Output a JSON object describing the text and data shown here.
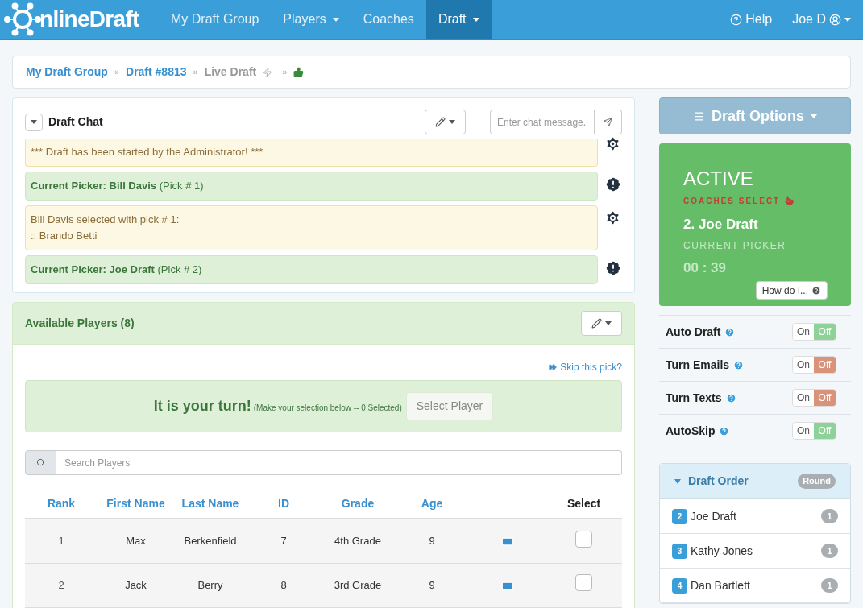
{
  "navbar": {
    "logo_text": "nlineDraft",
    "items": [
      {
        "label": "My Draft Group",
        "dropdown": false,
        "selected": false
      },
      {
        "label": "Players",
        "dropdown": true,
        "selected": false
      },
      {
        "label": "Coaches",
        "dropdown": false,
        "selected": false
      },
      {
        "label": "Draft",
        "dropdown": true,
        "selected": true
      }
    ],
    "help": "Help",
    "user": "Joe D"
  },
  "breadcrumb": {
    "links": [
      "My Draft Group",
      "Draft #8813"
    ],
    "separator": "»",
    "current": "Live Draft"
  },
  "chat": {
    "title": "Draft Chat",
    "placeholder": "Enter chat message.",
    "messages": [
      {
        "kind": "system",
        "lines": [
          "*** Draft has been started by the Administrator! ***"
        ]
      },
      {
        "kind": "picker",
        "bold": "Current Picker: Bill Davis",
        "note": "(Pick # 1)"
      },
      {
        "kind": "system",
        "lines": [
          "Bill Davis selected with pick # 1:",
          ":: Brando Betti"
        ]
      },
      {
        "kind": "picker",
        "bold": "Current Picker: Joe Draft",
        "note": "(Pick # 2)"
      }
    ]
  },
  "players": {
    "title": "Available Players (8)",
    "skip_link": "Skip this pick?",
    "turn_title": "It is your turn!",
    "turn_note": "(Make your selection below -- 0 Selected)",
    "select_button": "Select Player",
    "search_placeholder": "Search Players",
    "columns": [
      "Rank",
      "First Name",
      "Last Name",
      "ID",
      "Grade",
      "Age",
      "Select"
    ],
    "rows": [
      {
        "rank": "1",
        "first": "Max",
        "last": "Berkenfield",
        "id": "7",
        "grade": "4th Grade",
        "age": "9",
        "checked": false
      },
      {
        "rank": "2",
        "first": "Jack",
        "last": "Berry",
        "id": "8",
        "grade": "3rd Grade",
        "age": "9",
        "checked": false
      }
    ]
  },
  "options_button": "Draft Options",
  "status": {
    "state": "ACTIVE",
    "mode": "COACHES SELECT",
    "picker": "2. Joe Draft",
    "picker_label": "CURRENT PICKER",
    "timer": "00 : 39",
    "help_button": "How do I..."
  },
  "settings": [
    {
      "label": "Auto Draft",
      "on": false,
      "on_label": "On",
      "off_label": "Off",
      "color": "#8ed29a"
    },
    {
      "label": "Turn Emails",
      "on": false,
      "on_label": "On",
      "off_label": "Off",
      "color": "#d9937a"
    },
    {
      "label": "Turn Texts",
      "on": false,
      "on_label": "On",
      "off_label": "Off",
      "color": "#d9937a"
    },
    {
      "label": "AutoSkip",
      "on": false,
      "on_label": "On",
      "off_label": "Off",
      "color": "#8ed29a"
    }
  ],
  "draft_order": {
    "title": "Draft Order",
    "badge": "Round",
    "expanded": true,
    "entries": [
      {
        "pick": "2",
        "name": "Joe Draft",
        "round": "1"
      },
      {
        "pick": "3",
        "name": "Kathy Jones",
        "round": "1"
      },
      {
        "pick": "4",
        "name": "Dan Bartlett",
        "round": "1"
      }
    ]
  }
}
